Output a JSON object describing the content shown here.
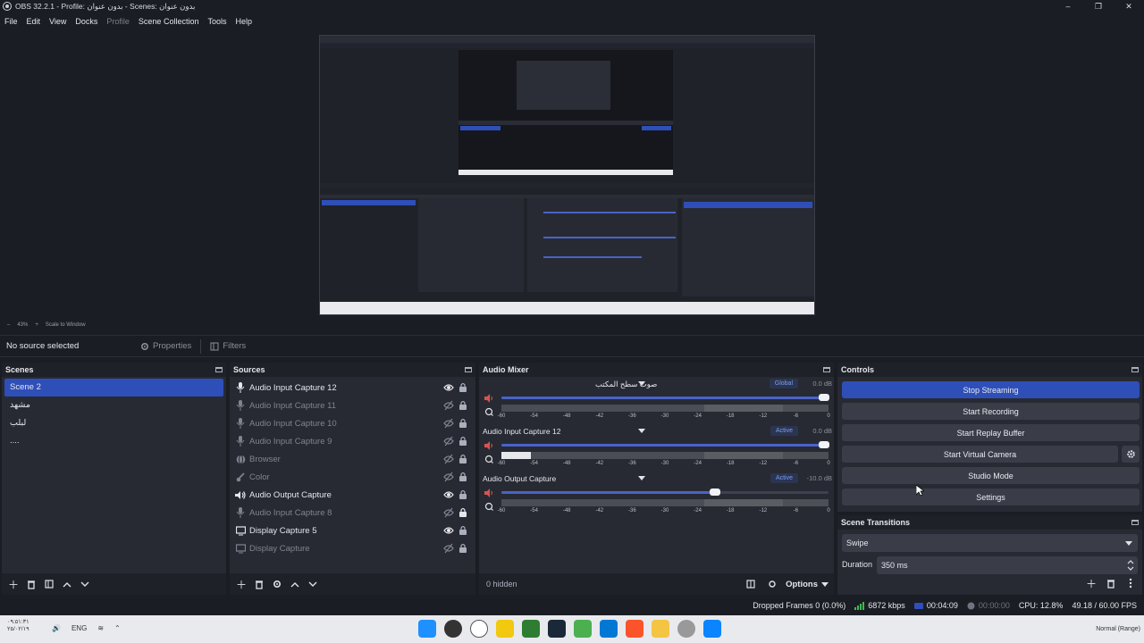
{
  "window": {
    "title": "OBS 32.2.1 - Profile: بدون عنوان - Scenes: بدون عنوان",
    "min": "–",
    "max": "❐",
    "close": "✕"
  },
  "menu": [
    "File",
    "Edit",
    "View",
    "Docks",
    "Profile",
    "Scene Collection",
    "Tools",
    "Help"
  ],
  "zoom": {
    "minus": "–",
    "level": "43%",
    "plus": "+",
    "mode": "Scale to Window"
  },
  "context": {
    "no_source": "No source selected",
    "properties": "Properties",
    "filters": "Filters"
  },
  "scenes": {
    "title": "Scenes",
    "items": [
      "Scene 2",
      "مشهد",
      "لبلب",
      "...."
    ]
  },
  "sources": {
    "title": "Sources",
    "items": [
      {
        "label": "Audio Input Capture 12",
        "icon": "mic-icon",
        "visible": true,
        "locked": false
      },
      {
        "label": "Audio Input Capture 11",
        "icon": "mic-icon",
        "visible": false,
        "locked": false
      },
      {
        "label": "Audio Input Capture 10",
        "icon": "mic-icon",
        "visible": false,
        "locked": false
      },
      {
        "label": "Audio Input Capture 9",
        "icon": "mic-icon",
        "visible": false,
        "locked": false
      },
      {
        "label": "Browser",
        "icon": "globe-icon",
        "visible": false,
        "locked": false
      },
      {
        "label": "Color",
        "icon": "brush-icon",
        "visible": false,
        "locked": false
      },
      {
        "label": "Audio Output Capture",
        "icon": "speaker-icon",
        "visible": true,
        "locked": false
      },
      {
        "label": "Audio Input Capture 8",
        "icon": "mic-icon",
        "visible": false,
        "locked": true
      },
      {
        "label": "Display Capture 5",
        "icon": "monitor-icon",
        "visible": true,
        "locked": false
      },
      {
        "label": "Display Capture",
        "icon": "monitor-icon",
        "visible": false,
        "locked": false
      }
    ]
  },
  "mixer": {
    "title": "Audio Mixer",
    "channels": [
      {
        "name": "صوت سطح المكتب",
        "badge": "Global",
        "db": "0.0 dB",
        "fader": 0.98,
        "meter_left": 0.0,
        "meter_right": 0.0
      },
      {
        "name": "Audio Input Capture 12",
        "badge": "Active",
        "db": "0.0 dB",
        "fader": 0.98,
        "meter_left": 0.09,
        "meter_right": 0.09
      },
      {
        "name": "Audio Output Capture",
        "badge": "Active",
        "db": "-10.0 dB",
        "fader": 0.65,
        "meter_left": 0.0,
        "meter_right": 0.0
      }
    ],
    "scale": [
      "-60",
      "-54",
      "-48",
      "-42",
      "-36",
      "-30",
      "-24",
      "-18",
      "-12",
      "-6",
      "0"
    ],
    "hidden": "0 hidden",
    "options": "Options"
  },
  "controls": {
    "title": "Controls",
    "stop_streaming": "Stop Streaming",
    "start_recording": "Start Recording",
    "start_replay": "Start Replay Buffer",
    "start_virtual_camera": "Start Virtual Camera",
    "studio_mode": "Studio Mode",
    "settings": "Settings"
  },
  "transitions": {
    "title": "Scene Transitions",
    "selected": "Swipe",
    "duration_label": "Duration",
    "duration": "350 ms"
  },
  "status": {
    "dropped": "Dropped Frames 0 (0.0%)",
    "kbps": "6872 kbps",
    "stream_time": "00:04:09",
    "rec_time": "00:00:00",
    "cpu": "CPU: 12.8%",
    "fps": "49.18 / 60.00 FPS"
  },
  "taskbar": {
    "time": "٠٩:٥١:٣١",
    "date": "٢٥/٠٢/١٩",
    "lang": "ENG",
    "right": "Normal (Range)"
  },
  "colors": {
    "accent": "#2f4fb8",
    "panel": "#272a33",
    "background": "#1b1d24"
  }
}
